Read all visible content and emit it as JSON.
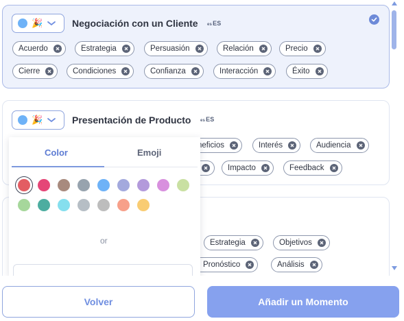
{
  "colors": {
    "accent": "#6d8ad8",
    "selected_card_bg": "#eef2fc",
    "dot": "#6eb2f7",
    "primary_button": "#86a1ee"
  },
  "moments": [
    {
      "title": "Negociación con un Cliente",
      "lang_code": "es",
      "lang_label": "ES",
      "selected": true,
      "emoji": "🎉",
      "tags": [
        "Acuerdo",
        "Estrategia",
        "Persuasión",
        "Relación",
        "Precio",
        "Cierre",
        "Condiciones",
        "Confianza",
        "Interacción",
        "Éxito"
      ]
    },
    {
      "title": "Presentación de Producto",
      "lang_code": "es",
      "lang_label": "ES",
      "selected": false,
      "emoji": "🎉",
      "tags": [
        "neficios",
        "Interés",
        "Audiencia",
        "Impacto",
        "Feedback"
      ]
    },
    {
      "title": "",
      "tags": [
        "Estrategia",
        "Objetivos",
        "Pronóstico",
        "Análisis"
      ]
    }
  ],
  "icons": {
    "selector_chevron": "chevron-down-icon",
    "check": "check-circle-icon",
    "tag_remove": "close-circle-icon"
  },
  "picker": {
    "tabs": [
      "Color",
      "Emoji"
    ],
    "active_tab": "Color",
    "colors": [
      "#e35d63",
      "#e54677",
      "#a88a7e",
      "#97a3ae",
      "#6eb2f7",
      "#a3a9dd",
      "#b39adb",
      "#d890de",
      "#c9e0a2",
      "#a6d79b",
      "#4dada0",
      "#85dfee",
      "#b6bec5",
      "#bdbdbd",
      "#f7a08a",
      "#f9cc73"
    ],
    "selected_color_index": 0,
    "or_label": "or"
  },
  "buttons": {
    "back": "Volver",
    "add": "Añadir un Momento"
  }
}
